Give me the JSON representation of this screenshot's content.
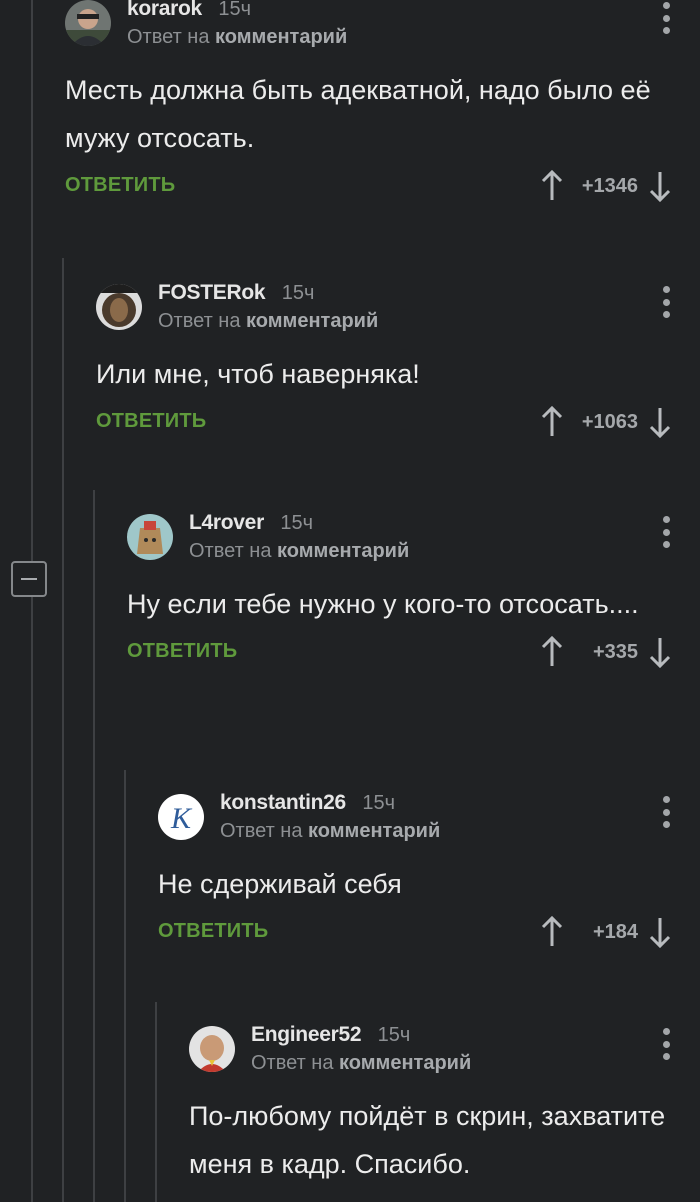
{
  "comments": [
    {
      "author": "korarok",
      "time": "15ч",
      "reply_prefix": "Ответ на",
      "reply_target": "комментарий",
      "text": "Месть должна быть адекватной, надо было её мужу отсосать.",
      "reply_label": "ОТВЕТИТЬ",
      "rating": "+1346"
    },
    {
      "author": "FOSTERok",
      "time": "15ч",
      "reply_prefix": "Ответ на",
      "reply_target": "комментарий",
      "text": "Или мне, чтоб наверняка!",
      "reply_label": "ОТВЕТИТЬ",
      "rating": "+1063"
    },
    {
      "author": "L4rover",
      "time": "15ч",
      "reply_prefix": "Ответ на",
      "reply_target": "комментарий",
      "text": "Ну если тебе нужно у кого-то отсосать....",
      "reply_label": "ОТВЕТИТЬ",
      "rating": "+335"
    },
    {
      "author": "konstantin26",
      "time": "15ч",
      "reply_prefix": "Ответ на",
      "reply_target": "комментарий",
      "text": "Не сдерживай себя",
      "reply_label": "ОТВЕТИТЬ",
      "rating": "+184"
    },
    {
      "author": "Engineer52",
      "time": "15ч",
      "reply_prefix": "Ответ на",
      "reply_target": "комментарий",
      "text": "По-любому пойдёт в скрин, захватите меня в кадр. Спасибо.",
      "reply_label": "",
      "rating": ""
    }
  ],
  "colors": {
    "background": "#202224",
    "thread_line": "#3e4043",
    "reply_green": "#5f9a3c",
    "meta_gray": "#8d9093"
  }
}
